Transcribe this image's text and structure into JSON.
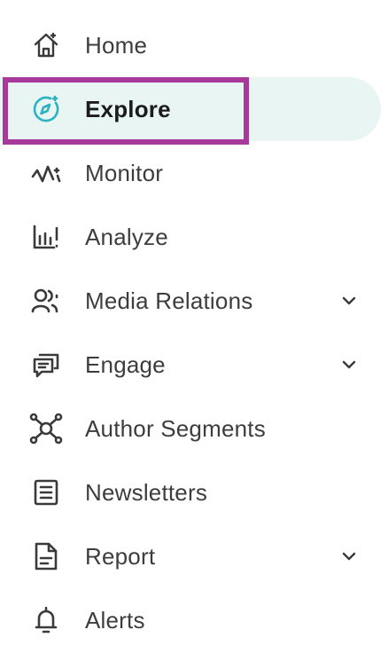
{
  "theme": {
    "active_bg": "#e9f5f3",
    "highlight_border": "#a7399b",
    "active_icon": "#2bb3bf",
    "icon_color": "#3a3a3a"
  },
  "nav": {
    "items": [
      {
        "label": "Home",
        "icon": "home-icon"
      },
      {
        "label": "Explore",
        "icon": "compass-icon",
        "active": true
      },
      {
        "label": "Monitor",
        "icon": "monitor-pulse-icon"
      },
      {
        "label": "Analyze",
        "icon": "bar-chart-icon"
      },
      {
        "label": "Media Relations",
        "icon": "people-icon",
        "expandable": true
      },
      {
        "label": "Engage",
        "icon": "chat-bubbles-icon",
        "expandable": true
      },
      {
        "label": "Author Segments",
        "icon": "network-icon"
      },
      {
        "label": "Newsletters",
        "icon": "newsletter-icon"
      },
      {
        "label": "Report",
        "icon": "report-document-icon",
        "expandable": true
      },
      {
        "label": "Alerts",
        "icon": "bell-icon"
      }
    ]
  }
}
